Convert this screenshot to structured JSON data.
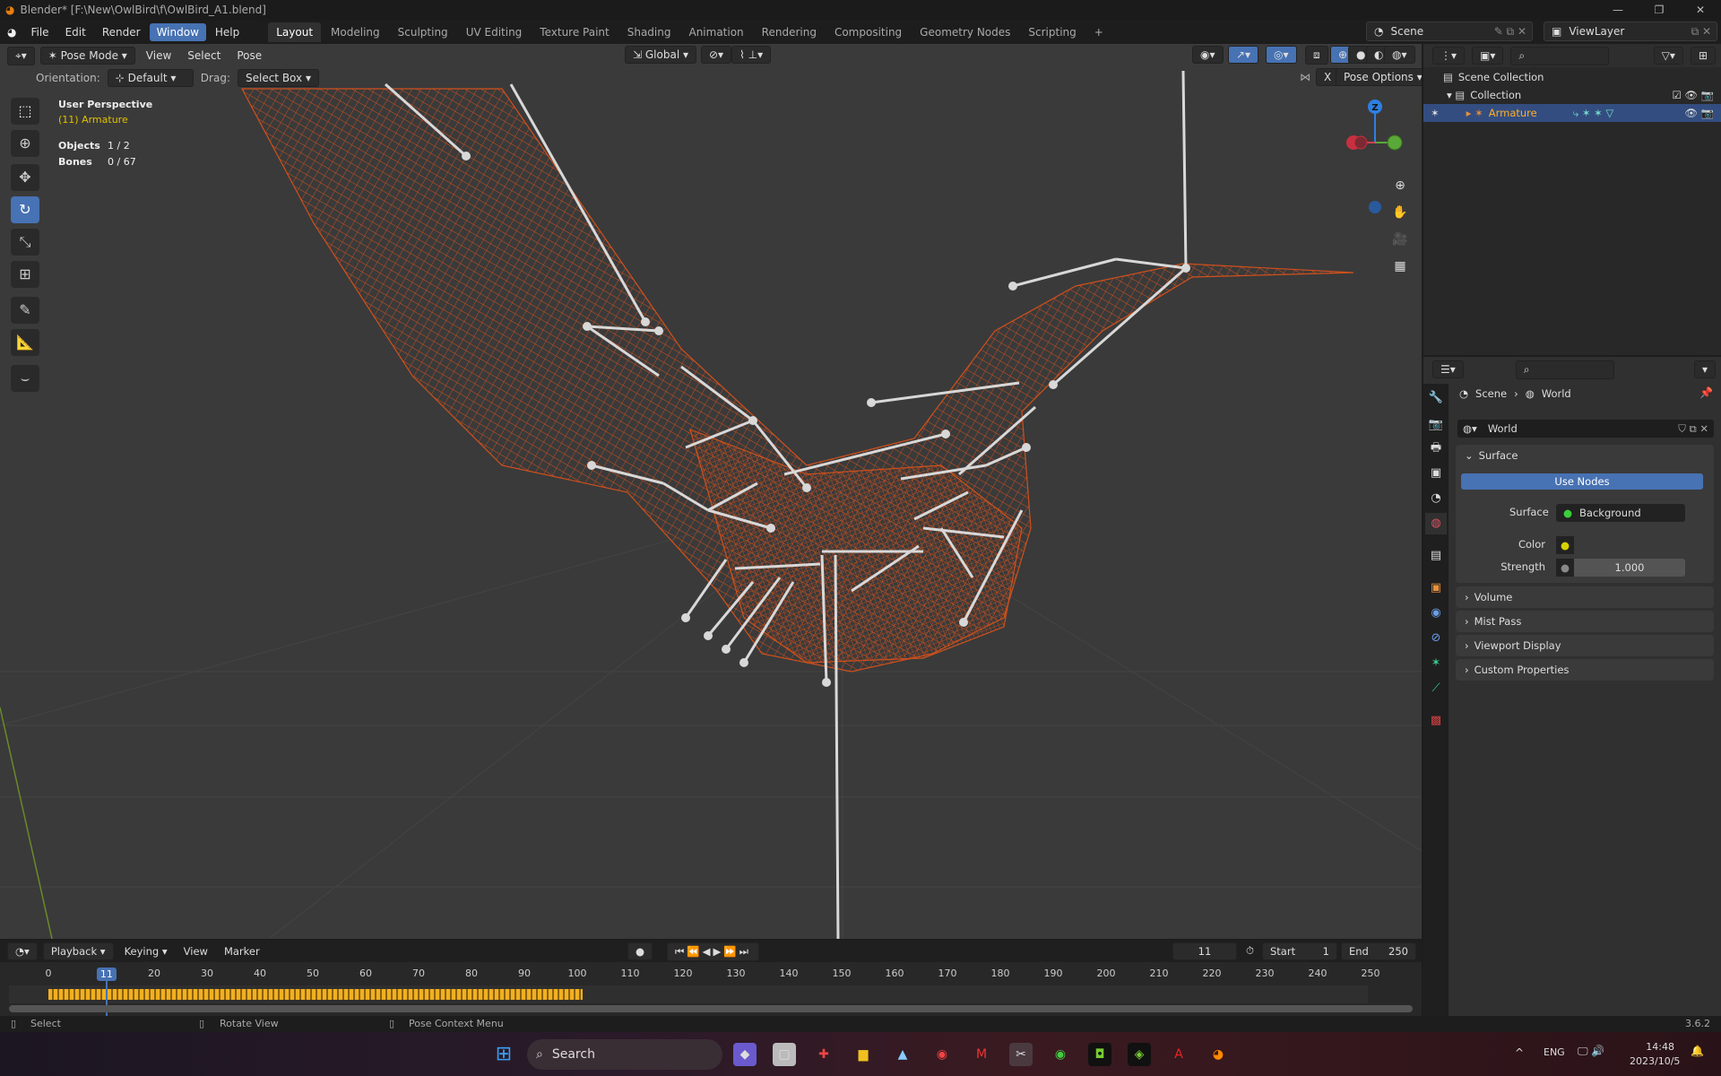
{
  "window": {
    "title": "Blender* [F:\\New\\OwlBird\\f\\OwlBird_A1.blend]"
  },
  "menu": [
    "File",
    "Edit",
    "Render",
    "Window",
    "Help"
  ],
  "workspaces": [
    "Layout",
    "Modeling",
    "Sculpting",
    "UV Editing",
    "Texture Paint",
    "Shading",
    "Animation",
    "Rendering",
    "Compositing",
    "Geometry Nodes",
    "Scripting",
    "+"
  ],
  "scene": {
    "name": "Scene",
    "view_layer": "ViewLayer"
  },
  "viewport": {
    "mode": "Pose Mode",
    "menus": [
      "View",
      "Select",
      "Pose"
    ],
    "transform_orientation": "Global",
    "orientation_label": "Orientation:",
    "orientation_value": "Default",
    "drag_label": "Drag:",
    "drag_value": "Select Box",
    "pose_options": "Pose Options",
    "x_mirror": "X",
    "overlay_title": "User Perspective",
    "overlay_object": "(11) Armature",
    "objects_label": "Objects",
    "objects_value": "1 / 2",
    "bones_label": "Bones",
    "bones_value": "0 / 67",
    "gizmo_axis": "Z",
    "colors": {
      "mesh": "#d0501c",
      "bone": "#d8d8d8",
      "background": "#3a3a3a"
    }
  },
  "outliner": {
    "items": [
      {
        "label": "Scene Collection"
      },
      {
        "label": "Collection"
      },
      {
        "label": "Armature"
      }
    ]
  },
  "properties": {
    "breadcrumb": [
      "Scene",
      "World"
    ],
    "world_name": "World",
    "panels": {
      "surface": "Surface",
      "use_nodes": "Use Nodes",
      "surface_label": "Surface",
      "surface_value": "Background",
      "color_label": "Color",
      "strength_label": "Strength",
      "strength_value": "1.000"
    },
    "collapsed": [
      "Volume",
      "Mist Pass",
      "Viewport Display",
      "Custom Properties"
    ]
  },
  "timeline": {
    "menus": [
      "Playback",
      "Keying",
      "View",
      "Marker"
    ],
    "current_frame": "11",
    "start_label": "Start",
    "start": "1",
    "end_label": "End",
    "end": "250",
    "ticks": [
      "0",
      "11",
      "20",
      "30",
      "40",
      "50",
      "60",
      "70",
      "80",
      "90",
      "100",
      "110",
      "120",
      "130",
      "140",
      "150",
      "160",
      "170",
      "180",
      "190",
      "200",
      "210",
      "220",
      "230",
      "240",
      "250"
    ],
    "keyframe_range": [
      0,
      101
    ]
  },
  "status": {
    "select": "Select",
    "rotate": "Rotate View",
    "context": "Pose Context Menu",
    "version": "3.6.2"
  },
  "taskbar": {
    "search": "Search",
    "lang": "ENG",
    "time": "14:48",
    "date": "2023/10/5"
  }
}
